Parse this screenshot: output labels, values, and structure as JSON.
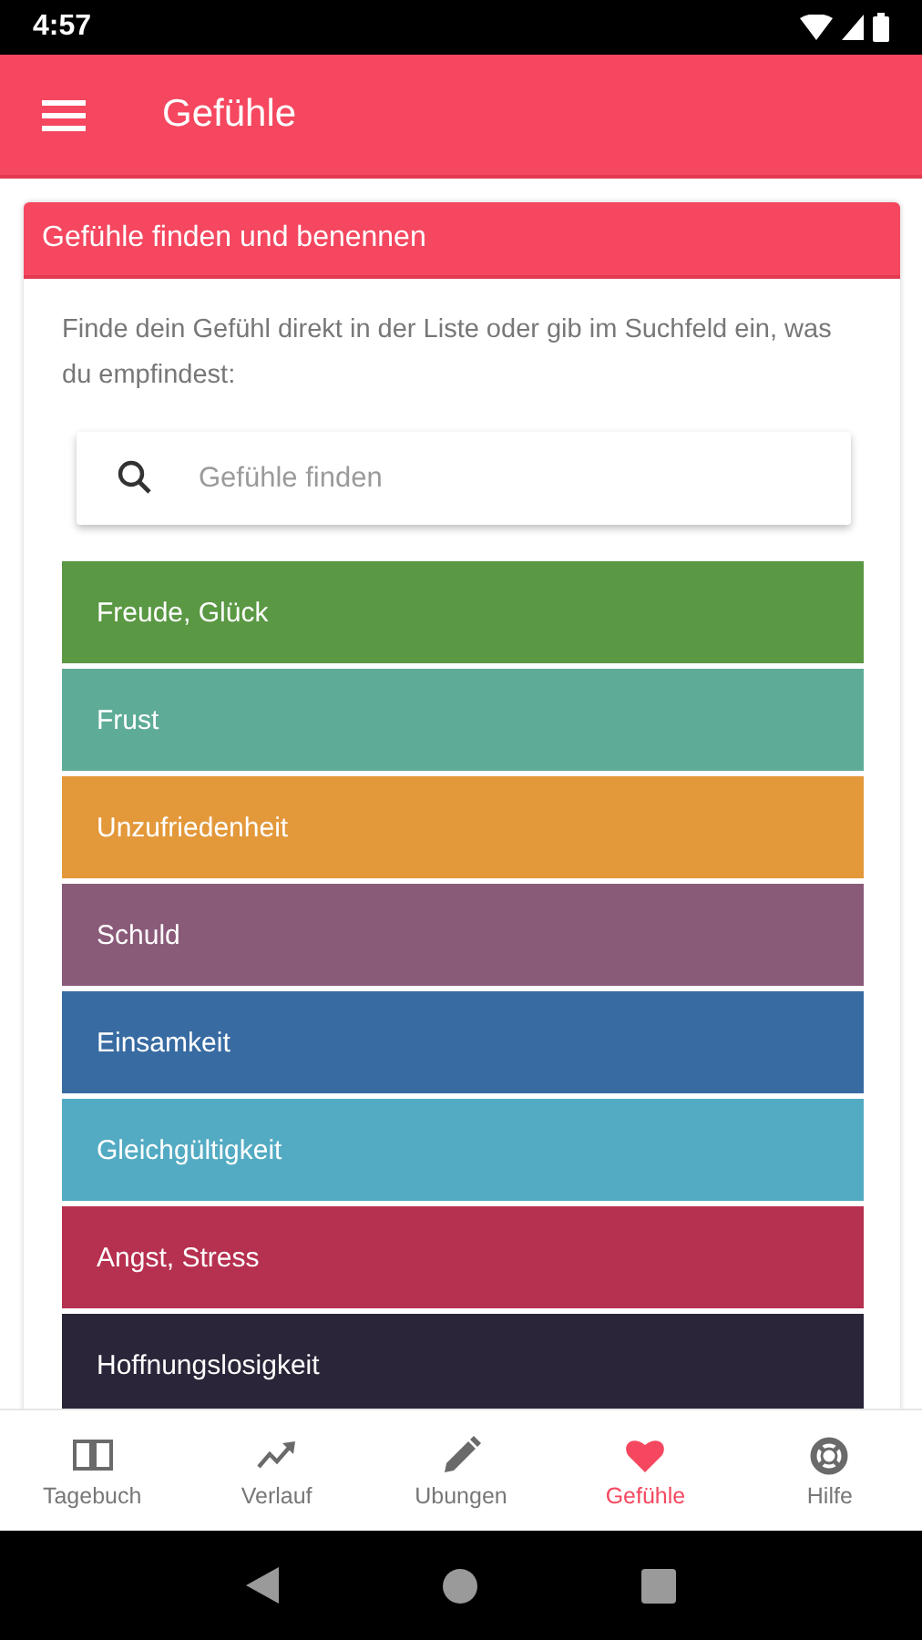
{
  "status_bar": {
    "time": "4:57"
  },
  "app_bar": {
    "title": "Gefühle"
  },
  "card": {
    "title": "Gefühle finden und benennen",
    "intro": "Finde dein Gefühl direkt in der Liste oder gib im Suchfeld ein, was du empfindest:",
    "search": {
      "placeholder": "Gefühle finden"
    },
    "feelings": [
      {
        "label": "Freude, Glück",
        "color": "#5a9844"
      },
      {
        "label": "Frust",
        "color": "#5eab98"
      },
      {
        "label": "Unzufriedenheit",
        "color": "#e3983a"
      },
      {
        "label": "Schuld",
        "color": "#8a5b79"
      },
      {
        "label": "Einsamkeit",
        "color": "#386ba2"
      },
      {
        "label": "Gleichgültigkeit",
        "color": "#53abc3"
      },
      {
        "label": "Angst, Stress",
        "color": "#b6304f"
      },
      {
        "label": "Hoffnungslosigkeit",
        "color": "#2a2538"
      }
    ]
  },
  "bottom_nav": [
    {
      "label": "Tagebuch",
      "selected": false
    },
    {
      "label": "Verlauf",
      "selected": false
    },
    {
      "label": "Ubungen",
      "selected": false
    },
    {
      "label": "Gefühle",
      "selected": true
    },
    {
      "label": "Hilfe",
      "selected": false
    }
  ]
}
